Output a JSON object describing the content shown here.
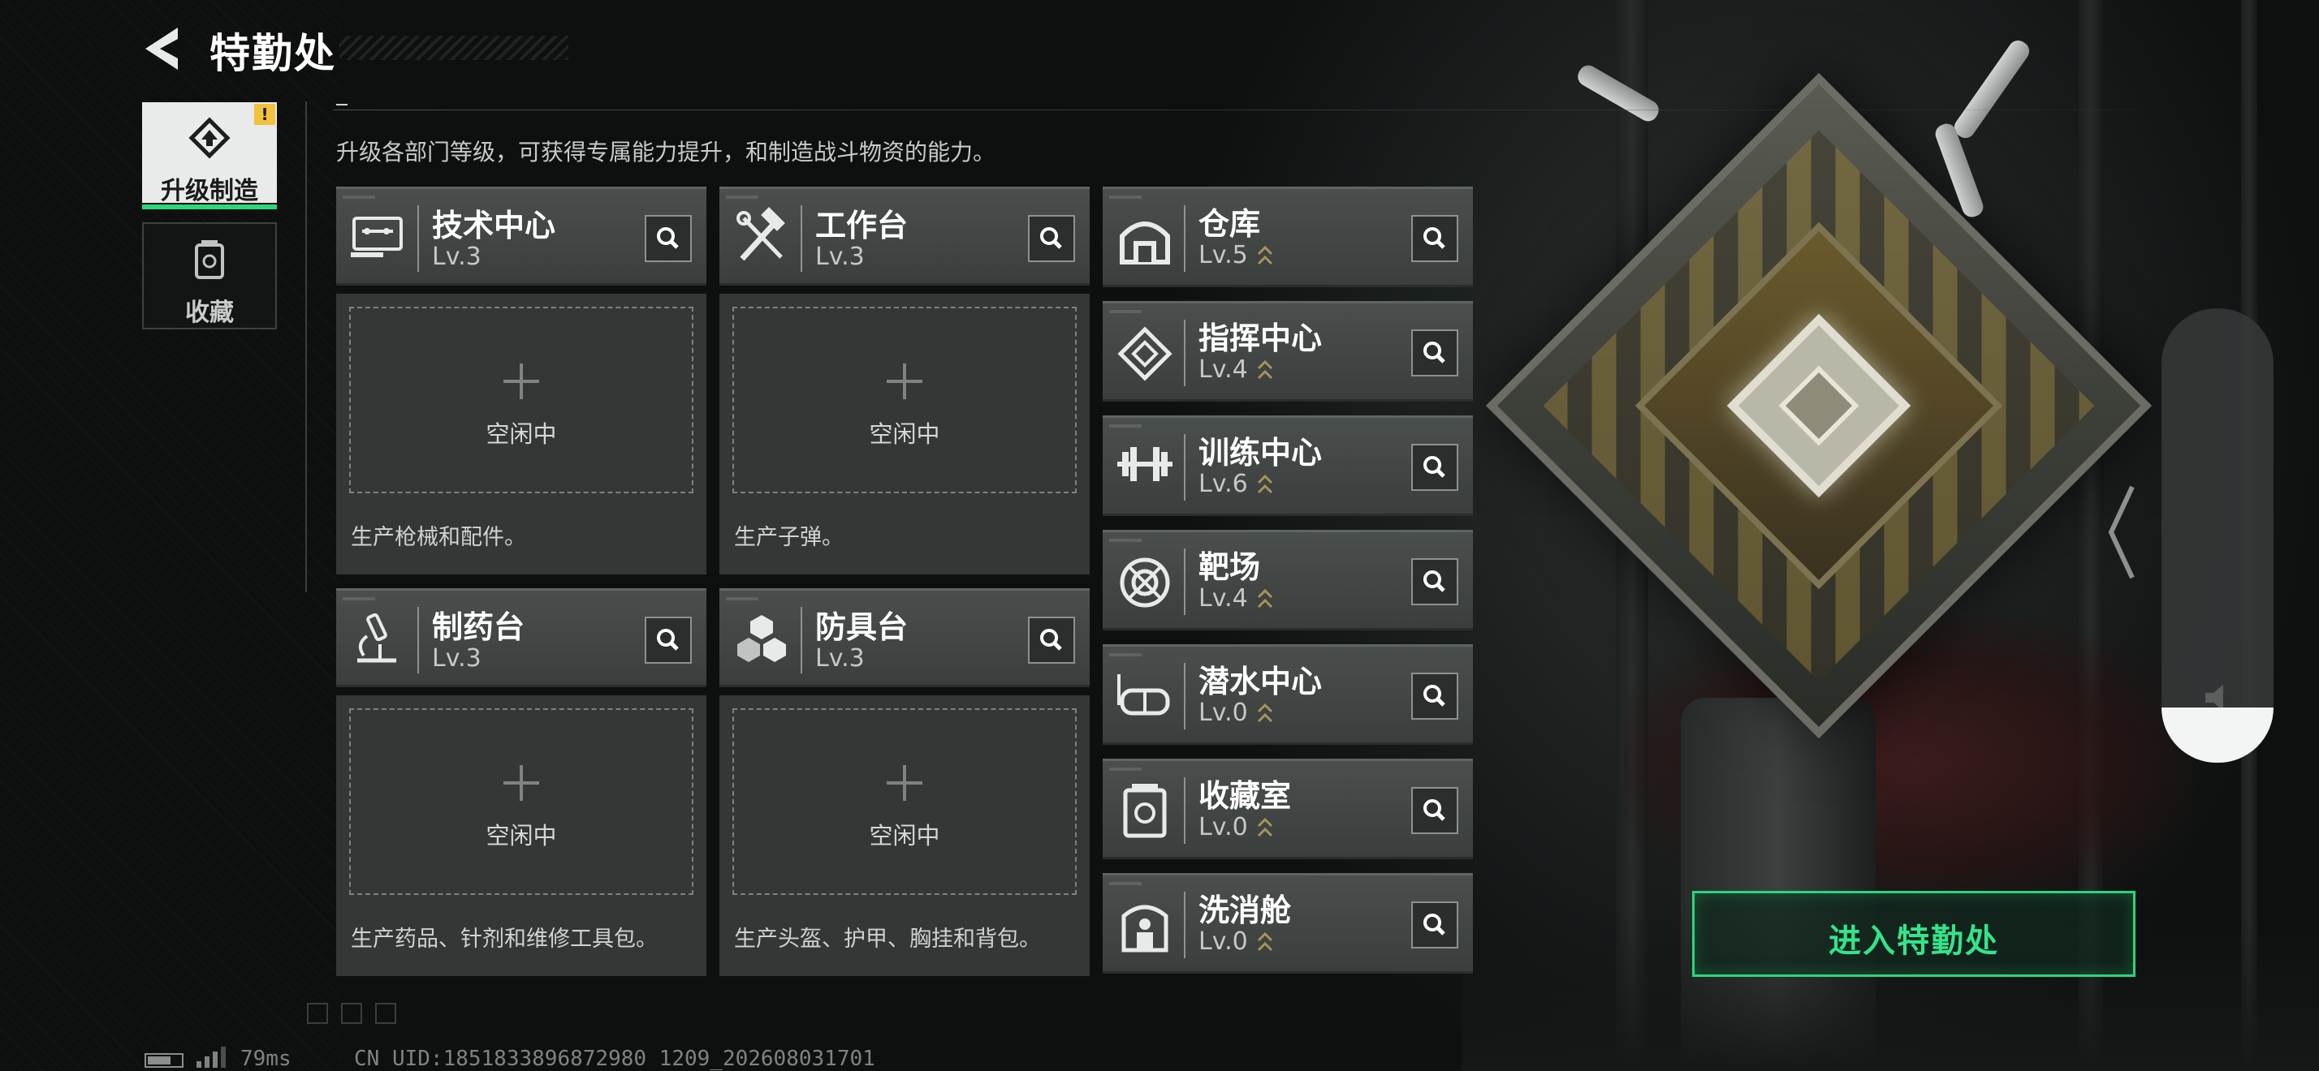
{
  "header": {
    "title": "特勤处"
  },
  "tabs": [
    {
      "label": "升级制造",
      "icon": "upgrade-icon",
      "active": true,
      "badge": "!"
    },
    {
      "label": "收藏",
      "icon": "collection-icon",
      "active": false
    }
  ],
  "description": "升级各部门等级，可获得专属能力提升，和制造战斗物资的能力。",
  "production": [
    {
      "name": "技术中心",
      "level": "Lv.3",
      "icon": "tech-center-icon",
      "status": "空闲中",
      "desc": "生产枪械和配件。"
    },
    {
      "name": "工作台",
      "level": "Lv.3",
      "icon": "workbench-icon",
      "status": "空闲中",
      "desc": "生产子弹。"
    },
    {
      "name": "制药台",
      "level": "Lv.3",
      "icon": "pharmacy-icon",
      "status": "空闲中",
      "desc": "生产药品、针剂和维修工具包。"
    },
    {
      "name": "防具台",
      "level": "Lv.3",
      "icon": "armor-bench-icon",
      "status": "空闲中",
      "desc": "生产头盔、护甲、胸挂和背包。"
    }
  ],
  "facilities": [
    {
      "name": "仓库",
      "level": "Lv.5",
      "icon": "warehouse-icon"
    },
    {
      "name": "指挥中心",
      "level": "Lv.4",
      "icon": "command-center-icon"
    },
    {
      "name": "训练中心",
      "level": "Lv.6",
      "icon": "training-center-icon"
    },
    {
      "name": "靶场",
      "level": "Lv.4",
      "icon": "shooting-range-icon"
    },
    {
      "name": "潜水中心",
      "level": "Lv.0",
      "icon": "diving-center-icon"
    },
    {
      "name": "收藏室",
      "level": "Lv.0",
      "icon": "collection-room-icon"
    },
    {
      "name": "洗消舱",
      "level": "Lv.0",
      "icon": "decon-chamber-icon"
    }
  ],
  "enter_button": "进入特勤处",
  "footer": {
    "ping": "79ms",
    "uid": "CN UID:1851833896872980 1209_202608031701"
  },
  "colors": {
    "accent": "#2ad67c",
    "badge": "#f2c23c",
    "card": "#3f4342"
  }
}
